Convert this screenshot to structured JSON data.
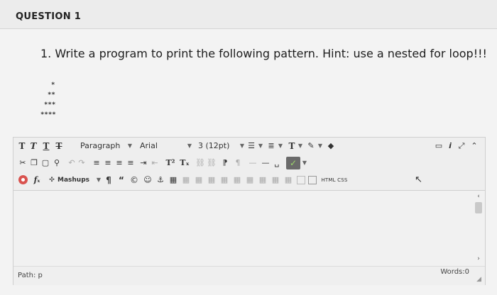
{
  "question": {
    "title": "QUESTION 1",
    "text": "1. Write a program to print the following pattern. Hint: use a nested for loop!!!",
    "pattern": [
      "*",
      "**",
      "***",
      "****"
    ]
  },
  "toolbar": {
    "row1": {
      "format_t1": "T",
      "format_t2": "T",
      "format_t3": "T",
      "format_t4": "T",
      "paragraph": "Paragraph",
      "font": "Arial",
      "size": "3 (12pt)",
      "text_color_t": "T"
    },
    "row2": {
      "superscript": "T²",
      "subscript": "Tₓ"
    },
    "row3": {
      "fx": "fₓ",
      "mashups": "Mashups",
      "pilcrow": "¶",
      "quote": "“",
      "copyright": "©",
      "html_css": "HTML CSS"
    }
  },
  "status": {
    "path": "Path: p",
    "words": "Words:0"
  }
}
